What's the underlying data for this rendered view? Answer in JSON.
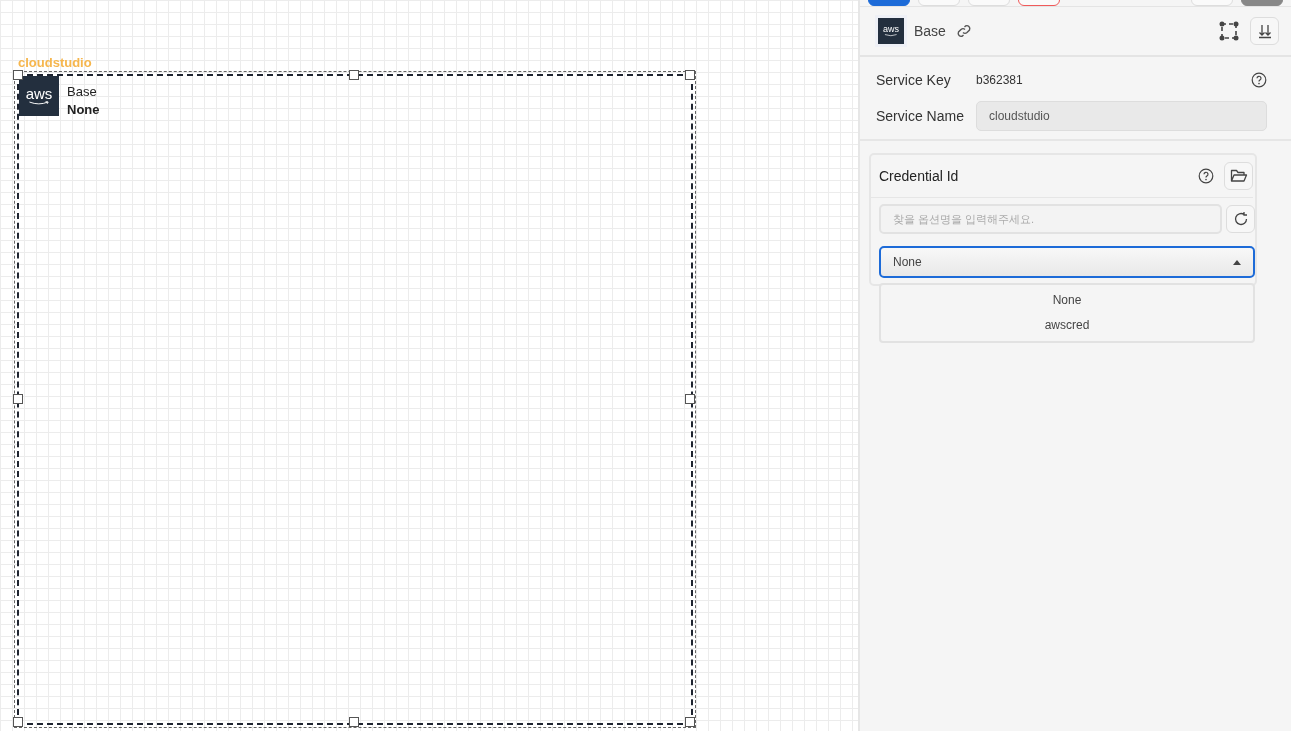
{
  "canvas": {
    "group_label": "cloudstudio",
    "node": {
      "logo": "aws",
      "title": "Base",
      "subtitle": "None"
    }
  },
  "panel": {
    "header": {
      "logo": "aws",
      "title": "Base"
    },
    "service_key": {
      "label": "Service Key",
      "value": "b362381"
    },
    "service_name": {
      "label": "Service Name",
      "value": "cloudstudio"
    },
    "credential": {
      "label": "Credential Id",
      "search": {
        "placeholder": "찾을 옵션명을 입력해주세요."
      },
      "select": {
        "value": "None",
        "expanded": true
      },
      "options": [
        {
          "label": "None",
          "selected": false
        },
        {
          "label": "awscred",
          "selected": false
        }
      ]
    }
  }
}
